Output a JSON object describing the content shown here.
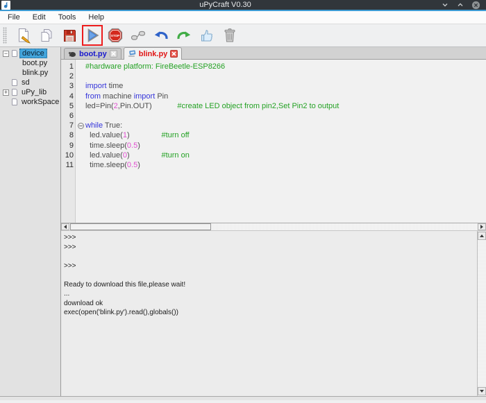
{
  "window": {
    "title": "uPyCraft V0.30"
  },
  "menu": {
    "items": [
      "File",
      "Edit",
      "Tools",
      "Help"
    ]
  },
  "toolbar": {
    "stop_label": "STOP",
    "buttons": [
      {
        "icon": "new-file-icon"
      },
      {
        "icon": "open-file-icon"
      },
      {
        "icon": "save-file-icon"
      },
      {
        "icon": "download-run-icon",
        "highlighted": true
      },
      {
        "icon": "stop-icon"
      },
      {
        "icon": "connect-icon"
      },
      {
        "icon": "undo-icon"
      },
      {
        "icon": "redo-icon"
      },
      {
        "icon": "syntax-check-icon"
      },
      {
        "icon": "clear-icon"
      }
    ]
  },
  "sidebar": {
    "items": [
      {
        "label": "device",
        "expander": "minus",
        "icon": true,
        "selected": true
      },
      {
        "label": "boot.py",
        "expander": null,
        "icon": false,
        "selected": false
      },
      {
        "label": "blink.py",
        "expander": null,
        "icon": false,
        "selected": false
      },
      {
        "label": "sd",
        "expander": null,
        "icon": true,
        "selected": false
      },
      {
        "label": "uPy_lib",
        "expander": "plus",
        "icon": true,
        "selected": false
      },
      {
        "label": "workSpace",
        "expander": null,
        "icon": true,
        "selected": false
      }
    ]
  },
  "tabs": [
    {
      "label": "boot.py",
      "active": false
    },
    {
      "label": "blink.py",
      "active": true
    }
  ],
  "editor": {
    "lines": [
      {
        "n": "1",
        "seg": [
          [
            "#hardware platform: FireBeetle-ESP8266",
            "com"
          ]
        ]
      },
      {
        "n": "2",
        "seg": []
      },
      {
        "n": "3",
        "seg": [
          [
            "import",
            "kw"
          ],
          [
            " time",
            "pl"
          ]
        ]
      },
      {
        "n": "4",
        "seg": [
          [
            "from",
            "kw"
          ],
          [
            " machine ",
            "pl"
          ],
          [
            "import",
            "kw"
          ],
          [
            " Pin",
            "pl"
          ]
        ]
      },
      {
        "n": "5",
        "seg": [
          [
            "led=Pin(",
            "pl"
          ],
          [
            "2",
            "num"
          ],
          [
            ",Pin.OUT)            ",
            "pl"
          ],
          [
            "#create LED object from pin2,Set Pin2 to output",
            "com"
          ]
        ]
      },
      {
        "n": "6",
        "seg": []
      },
      {
        "n": "7",
        "fold": true,
        "seg": [
          [
            "while",
            "kw"
          ],
          [
            " True:",
            "pl"
          ]
        ]
      },
      {
        "n": "8",
        "seg": [
          [
            "  led.value(",
            "pl"
          ],
          [
            "1",
            "num"
          ],
          [
            ")               ",
            "pl"
          ],
          [
            "#turn off",
            "com"
          ]
        ]
      },
      {
        "n": "9",
        "seg": [
          [
            "  time.sleep(",
            "pl"
          ],
          [
            "0.5",
            "num"
          ],
          [
            ")",
            "pl"
          ]
        ]
      },
      {
        "n": "10",
        "seg": [
          [
            "  led.value(",
            "pl"
          ],
          [
            "0",
            "num"
          ],
          [
            ")               ",
            "pl"
          ],
          [
            "#turn on",
            "com"
          ]
        ]
      },
      {
        "n": "11",
        "seg": [
          [
            "  time.sleep(",
            "pl"
          ],
          [
            "0.5",
            "num"
          ],
          [
            ")",
            "pl"
          ]
        ]
      }
    ]
  },
  "console": {
    "lines": [
      ">>> ",
      ">>> ",
      "",
      ">>> ",
      "",
      "Ready to download this file,please wait!",
      "...",
      "download ok",
      "exec(open('blink.py').read(),globals())"
    ]
  },
  "colors": {
    "titlebar": "#31363b",
    "accent_line": "#3d9bd4",
    "tree_selection": "#43a5dc",
    "comment_green": "#23a123",
    "keyword_blue": "#3434da",
    "number_magenta": "#e050d0",
    "tab_active_text": "#e01616",
    "tab_inactive_text": "#1a1acd",
    "run_highlight_box": "#ec1c1c"
  }
}
